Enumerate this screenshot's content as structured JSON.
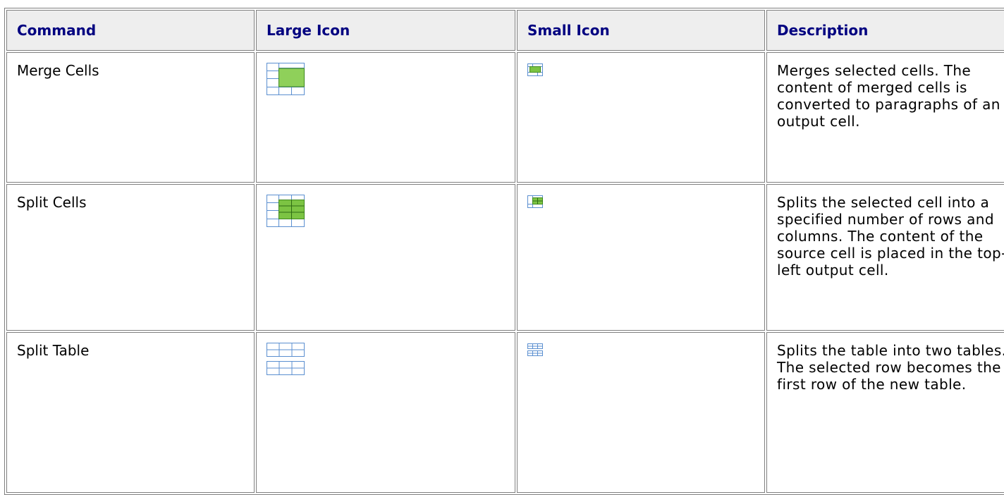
{
  "table": {
    "headers": {
      "command": "Command",
      "large_icon": "Large Icon",
      "small_icon": "Small Icon",
      "description": "Description"
    },
    "rows": [
      {
        "command": "Merge Cells",
        "large_icon": "merge-cells-icon",
        "small_icon": "merge-cells-icon",
        "description": "Merges selected cells. The content of merged cells is converted to paragraphs of an output cell."
      },
      {
        "command": "Split Cells",
        "large_icon": "split-cells-icon",
        "small_icon": "split-cells-icon",
        "description": "Splits the selected cell into a specified number of rows and columns. The content of the source cell is placed in the top-left output cell."
      },
      {
        "command": "Split Table",
        "large_icon": "split-table-icon",
        "small_icon": "split-table-icon",
        "description": "Splits the table into two tables. The selected row becomes the first row of the new table."
      }
    ]
  },
  "colors": {
    "header_text": "#000080",
    "header_bg": "#eeeeee",
    "border": "#808080",
    "icon_grid": "#5b8fd0",
    "icon_green": "#7cc443"
  }
}
